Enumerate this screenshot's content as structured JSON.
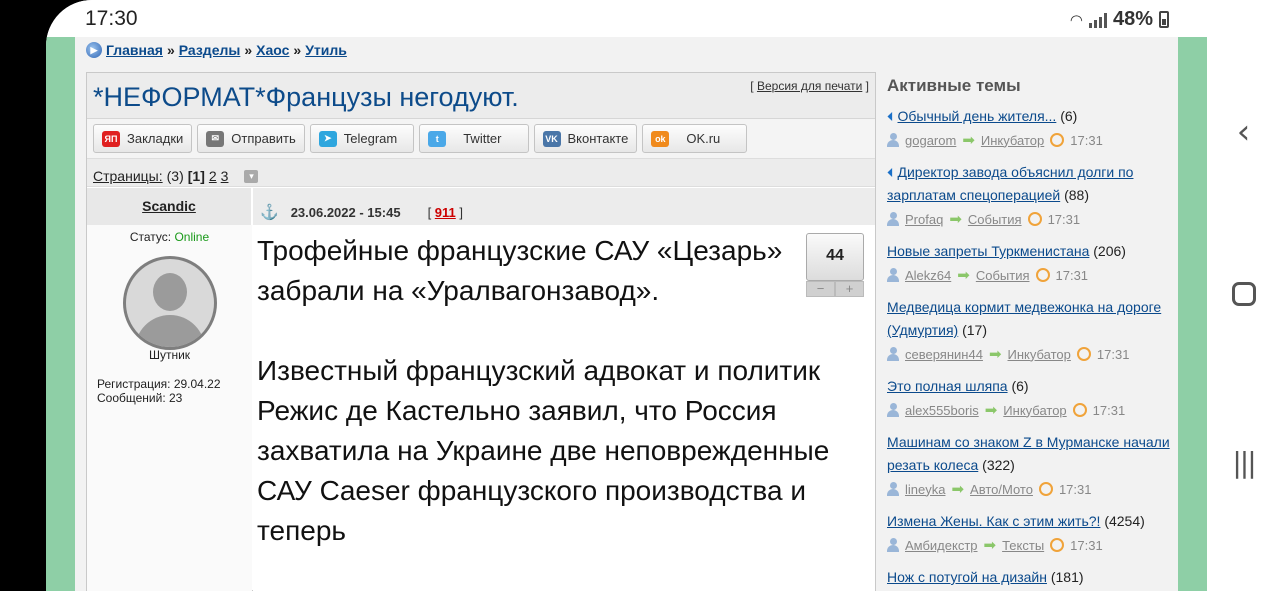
{
  "statusbar": {
    "time": "17:30",
    "battery": "48%"
  },
  "breadcrumb": [
    {
      "label": "Главная"
    },
    {
      "label": "Разделы"
    },
    {
      "label": "Хаос"
    },
    {
      "label": "Утиль"
    }
  ],
  "breadcrumb_sep": "»",
  "topic": {
    "title": "*НЕФОРМАТ*Французы негодуют.",
    "print_label": "Версия для печати"
  },
  "share": [
    {
      "label": "Закладки",
      "icon": "yandex-icon",
      "abbr": "ЯП",
      "color": "#e02020"
    },
    {
      "label": "Отправить",
      "icon": "mail-icon",
      "abbr": "✉",
      "color": "#777777"
    },
    {
      "label": "Telegram",
      "icon": "telegram-icon",
      "abbr": "➤",
      "color": "#2ea6de"
    },
    {
      "label": "Twitter",
      "icon": "twitter-icon",
      "abbr": "t",
      "color": "#4aa8e8"
    },
    {
      "label": "Вконтакте",
      "icon": "vk-icon",
      "abbr": "VK",
      "color": "#4a76a8"
    },
    {
      "label": "OK.ru",
      "icon": "ok-icon",
      "abbr": "ok",
      "color": "#f08a1c"
    }
  ],
  "pages": {
    "label": "Страницы:",
    "count": "(3)",
    "current": "[1]",
    "others": [
      "2",
      "3"
    ]
  },
  "post": {
    "author": "Scandic",
    "status_label": "Статус:",
    "status_value": "Online",
    "rank": "Шутник",
    "registration": "Регистрация: 29.04.22",
    "messages": "Сообщений: 23",
    "date": "23.06.2022 - 15:45",
    "number": "911",
    "rating": "44",
    "minus": "−",
    "plus": "+",
    "paragraph1": "Трофейные французские САУ «Цезарь» забрали на «Уралвагонзавод».",
    "paragraph2": "Известный французский адвокат и политик Режис де Кастельно заявил, что Россия захватила на Украине две неповрежденные САУ Caeser французского производства и теперь"
  },
  "active_topics": {
    "heading": "Активные темы",
    "items": [
      {
        "title": "Обычный день жителя...",
        "count": "(6)",
        "hot": true,
        "user": "gogarom",
        "section": "Инкубатор",
        "time": "17:31"
      },
      {
        "title": "Директор завода объяснил долги по зарплатам спецоперацией",
        "count": "(88)",
        "hot": true,
        "user": "Profaq",
        "section": "События",
        "time": "17:31"
      },
      {
        "title": "Новые запреты Туркменистана",
        "count": "(206)",
        "hot": false,
        "user": "Alekz64",
        "section": "События",
        "time": "17:31"
      },
      {
        "title": "Медведица кормит медвежонка на дороге (Удмуртия)",
        "count": "(17)",
        "hot": false,
        "user": "северянин44",
        "section": "Инкубатор",
        "time": "17:31"
      },
      {
        "title": "Это полная шляпа",
        "count": "(6)",
        "hot": false,
        "user": "alex555boris",
        "section": "Инкубатор",
        "time": "17:31"
      },
      {
        "title": "Машинам со знаком Z в Мурманске начали резать колеса",
        "count": "(322)",
        "hot": false,
        "user": "lineyka",
        "section": "Авто/Мото",
        "time": "17:31"
      },
      {
        "title": "Измена Жены. Как с этим жить?!",
        "count": "(4254)",
        "hot": false,
        "user": "Амбидекстр",
        "section": "Тексты",
        "time": "17:31"
      },
      {
        "title": "Нож с потугой на дизайн",
        "count": "(181)",
        "hot": false
      }
    ]
  }
}
